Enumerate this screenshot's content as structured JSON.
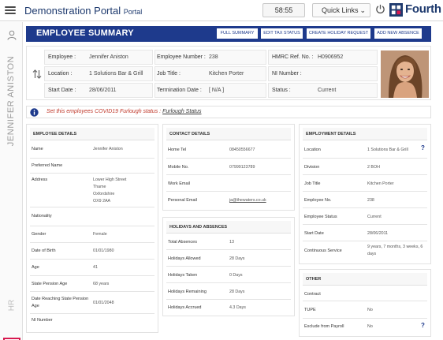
{
  "app": {
    "title": "Demonstration Portal",
    "subtitle": "Portal"
  },
  "topbar": {
    "timer": "58:55",
    "quick_links": "Quick Links",
    "brand": "Fourth"
  },
  "rail": {
    "employee_name": "JENNIFER ANISTON",
    "section": "HR"
  },
  "banner": {
    "title": "EMPLOYEE SUMMARY",
    "buttons": [
      "FULL SUMMARY",
      "EDIT TAX STATUS",
      "CREATE HOLIDAY REQUEST",
      "ADD NEW ABSENCE"
    ]
  },
  "summary": {
    "employee_label": "Employee :",
    "employee_value": "Jennifer Aniston",
    "location_label": "Location :",
    "location_value": "1 Solutions Bar & Grill",
    "start_label": "Start Date :",
    "start_value": "28/06/2011",
    "empno_label": "Employee Number :",
    "empno_value": "238",
    "jobtitle_label": "Job Title :",
    "jobtitle_value": "Kitchen Porter",
    "termdate_label": "Termination Date :",
    "termdate_value": "[ N/A ]",
    "hmrc_label": "HMRC Ref. No. :",
    "hmrc_value": "H0906952",
    "ni_label": "NI Number :",
    "ni_value": "",
    "status_label": "Status :",
    "status_value": "Current"
  },
  "furlough": {
    "text": "Set this employees COVID19 Furlough status : ",
    "link": "Furlough Status"
  },
  "employee_details": {
    "title": "EMPLOYEE DETAILS",
    "rows": [
      {
        "label": "Name",
        "value": "Jennifer Aniston"
      },
      {
        "label": "Preferred Name",
        "value": ""
      },
      {
        "label": "Address",
        "value": ""
      },
      {
        "label": "Nationality",
        "value": ""
      },
      {
        "label": "Gender",
        "value": "Female"
      },
      {
        "label": "Date of Birth",
        "value": "01/01/1980"
      },
      {
        "label": "Age",
        "value": "41"
      },
      {
        "label": "State Pension Age",
        "value": "68 years"
      },
      {
        "label": "Date Reaching State Pension",
        "label2": "Age",
        "value": "01/01/2048"
      },
      {
        "label": "NI Number",
        "value": ""
      }
    ],
    "address_lines": [
      "Lower High Street",
      "Thame",
      "Oxfordshire",
      "OX9 2AA"
    ]
  },
  "contact_details": {
    "title": "CONTACT DETAILS",
    "rows": [
      {
        "label": "Home Tel",
        "value": "08450556677"
      },
      {
        "label": "Mobile No.",
        "value": "07999123789"
      },
      {
        "label": "Work Email",
        "value": ""
      },
      {
        "label": "Personal Email",
        "value": "ja@thewaters.co.uk"
      }
    ]
  },
  "holidays": {
    "title": "HOLIDAYS AND ABSENCES",
    "rows": [
      {
        "label": "Total Absences",
        "value": "13"
      },
      {
        "label": "Holidays Allowed",
        "value": "28 Days"
      },
      {
        "label": "Holidays Taken",
        "value": "0 Days"
      },
      {
        "label": "Holidays Remaining",
        "value": "28 Days"
      },
      {
        "label": "Holidays Accrued",
        "value": "4.3 Days"
      }
    ]
  },
  "employment_details": {
    "title": "EMPLOYMENT DETAILS",
    "rows": [
      {
        "label": "Location",
        "value": "1 Solutions Bar & Grill"
      },
      {
        "label": "Division",
        "value": "2 BOH"
      },
      {
        "label": "Job Title",
        "value": "Kitchen Porter"
      },
      {
        "label": "Employee No.",
        "value": "238"
      },
      {
        "label": "Employee Status",
        "value": "Current"
      },
      {
        "label": "Start Date",
        "value": "28/06/2011"
      },
      {
        "label": "Continuous Service",
        "value": "9 years, 7 months, 3 weeks, 6",
        "value2": "days"
      }
    ]
  },
  "other": {
    "title": "OTHER",
    "rows": [
      {
        "label": "Contract",
        "value": ""
      },
      {
        "label": "TUPE",
        "value": "No"
      },
      {
        "label": "Exclude from Payroll",
        "value": "No"
      }
    ]
  },
  "help_symbol": "?",
  "colors": {
    "brand_blue": "#1e3a8c",
    "accent_red": "#d7194f",
    "furlough_red": "#c0392b"
  },
  "icons": [
    "menu-icon",
    "power-icon",
    "user-icon",
    "swap-icon",
    "info-icon",
    "close-icon",
    "help-icon"
  ]
}
